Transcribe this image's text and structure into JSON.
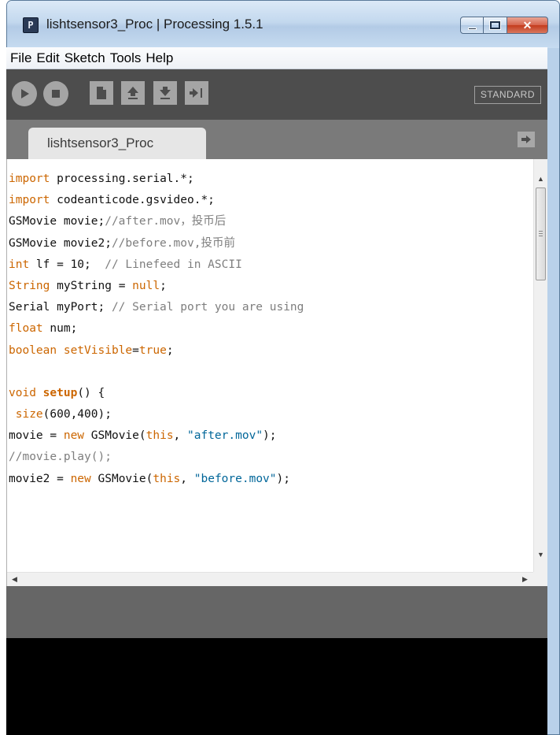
{
  "window": {
    "title": "lishtsensor3_Proc | Processing 1.5.1",
    "icon": "processing-app-icon",
    "controls": [
      "minimize",
      "maximize",
      "close"
    ]
  },
  "menu": [
    "File",
    "Edit",
    "Sketch",
    "Tools",
    "Help"
  ],
  "toolbar": {
    "buttons": [
      "run-icon",
      "stop-icon",
      "new-icon",
      "open-icon",
      "save-icon",
      "export-icon"
    ],
    "mode": "STANDARD"
  },
  "tabs": [
    {
      "label": "lishtsensor3_Proc",
      "active": true
    }
  ],
  "editor": {
    "lines": [
      "import processing.serial.*;",
      "import codeanticode.gsvideo.*;",
      "GSMovie movie;//after.mov，投币后",
      "GSMovie movie2;//before.mov,投币前",
      "int lf = 10;  // Linefeed in ASCII",
      "String myString = null;",
      "Serial myPort; // Serial port you are using",
      "float num;",
      "boolean setVisible=true;",
      "",
      "void setup() {",
      " size(600,400);",
      "movie = new GSMovie(this, \"after.mov\");",
      "//movie.play();",
      "movie2 = new GSMovie(this, \"before.mov\");"
    ]
  },
  "colors": {
    "keyword": "#cc6600",
    "string": "#006699",
    "comment": "#7e7e7e",
    "toolbar": "#4d4d4d",
    "tabstrip": "#7a7a7a",
    "status": "#666666",
    "console": "#000000"
  }
}
